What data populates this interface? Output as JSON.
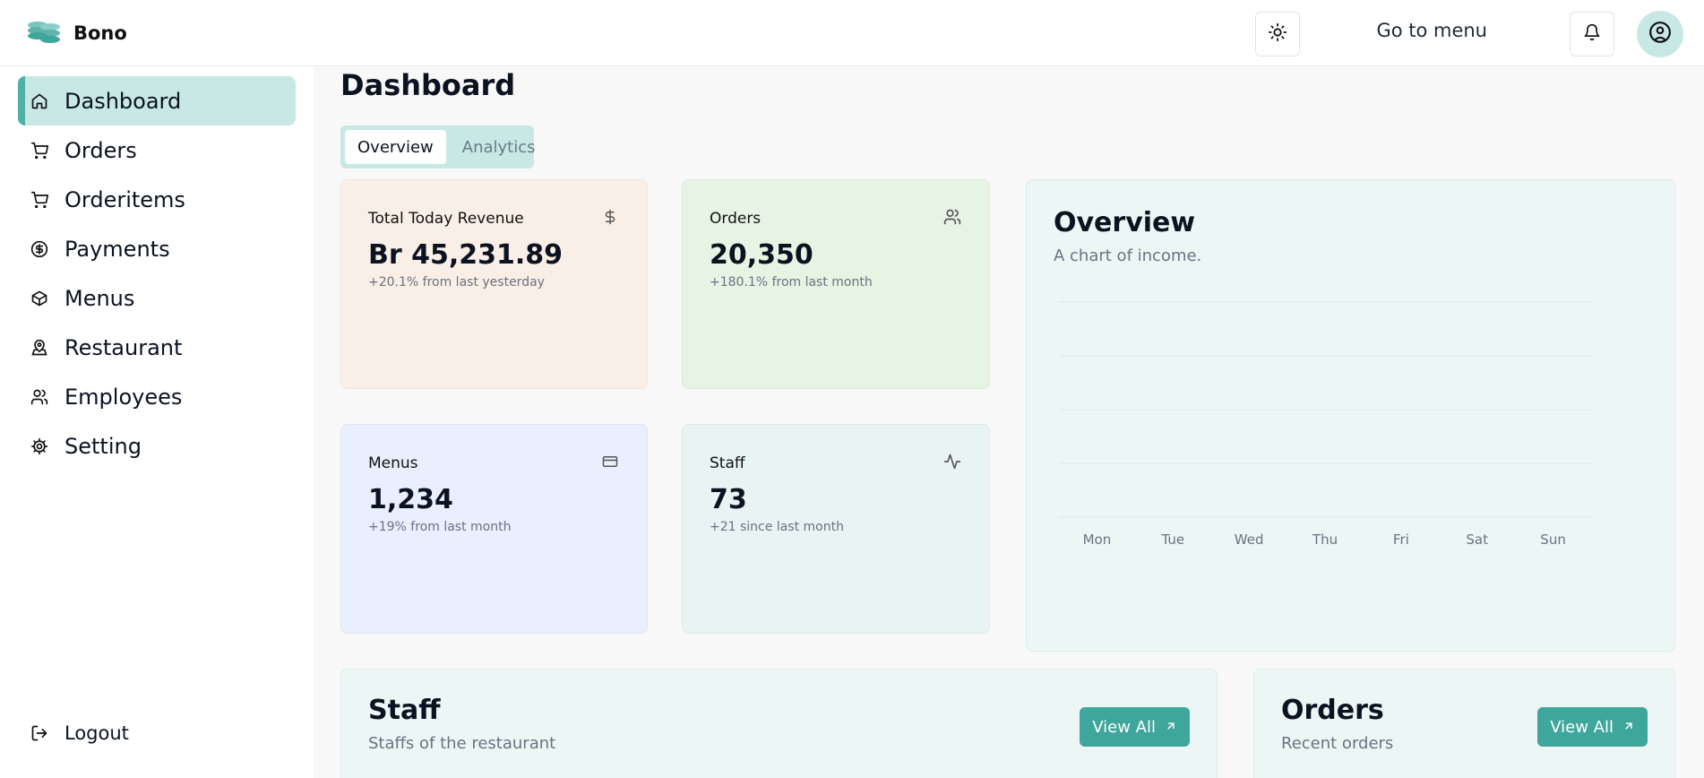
{
  "brand": {
    "name": "Bono"
  },
  "header": {
    "goto_menu": "Go to menu"
  },
  "sidebar": {
    "items": [
      {
        "label": "Dashboard"
      },
      {
        "label": "Orders"
      },
      {
        "label": "Orderitems"
      },
      {
        "label": "Payments"
      },
      {
        "label": "Menus"
      },
      {
        "label": "Restaurant"
      },
      {
        "label": "Employees"
      },
      {
        "label": "Setting"
      }
    ],
    "logout": "Logout"
  },
  "page": {
    "title": "Dashboard",
    "tabs": [
      {
        "label": "Overview"
      },
      {
        "label": "Analytics"
      }
    ]
  },
  "cards": {
    "revenue": {
      "label": "Total Today Revenue",
      "value": "Br 45,231.89",
      "sub": "+20.1% from last yesterday"
    },
    "orders": {
      "label": "Orders",
      "value": "20,350",
      "sub": "+180.1% from last month"
    },
    "menus": {
      "label": "Menus",
      "value": "1,234",
      "sub": "+19% from last month"
    },
    "staff": {
      "label": "Staff",
      "value": "73",
      "sub": "+21 since last month"
    }
  },
  "overview": {
    "title": "Overview",
    "subtitle": "A chart of income."
  },
  "chart_data": {
    "type": "bar",
    "categories": [
      "Mon",
      "Tue",
      "Wed",
      "Thu",
      "Fri",
      "Sat",
      "Sun"
    ],
    "values": [
      0,
      0,
      0,
      0,
      0,
      0,
      0
    ],
    "grid": true
  },
  "bottom": {
    "staff": {
      "title": "Staff",
      "subtitle": "Staffs of the restaurant",
      "button": "View All"
    },
    "orders": {
      "title": "Orders",
      "subtitle": "Recent orders",
      "button": "View All"
    }
  },
  "colors": {
    "accent": "#3fa69c",
    "active_nav": "#c8e8e6"
  }
}
